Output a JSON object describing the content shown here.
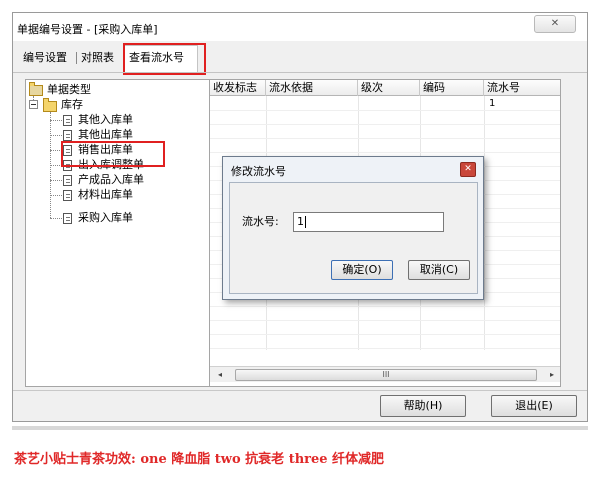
{
  "window": {
    "title": "单据编号设置 - [采购入库单]",
    "close_glyph": "✕"
  },
  "tabs": [
    {
      "label": "编号设置"
    },
    {
      "label": "对照表"
    },
    {
      "label": "查看流水号"
    }
  ],
  "tree": {
    "root": "单据类型",
    "group": "库存",
    "items": [
      "其他入库单",
      "其他出库单",
      "销售出库单",
      "出入库调整单",
      "产成品入库单",
      "材料出库单",
      "采购入库单"
    ]
  },
  "grid": {
    "columns": [
      "收发标志",
      "流水依据",
      "级次",
      "编码",
      "流水号"
    ],
    "rows": [
      {
        "serial": "1"
      }
    ],
    "scroll_left": "◂",
    "scroll_right": "▸",
    "scroll_thumb": "III"
  },
  "buttons": {
    "help": "帮助(H)",
    "exit": "退出(E)"
  },
  "dialog": {
    "title": "修改流水号",
    "close_glyph": "✕",
    "label": "流水号:",
    "value": "1",
    "ok": "确定(O)",
    "cancel": "取消(C)"
  },
  "tip": "茶艺小贴士青茶功效: one 降血脂  two 抗衰老   three  纤体减肥",
  "colors": {
    "highlight": "#e02020",
    "tip_text": "#e02828"
  }
}
